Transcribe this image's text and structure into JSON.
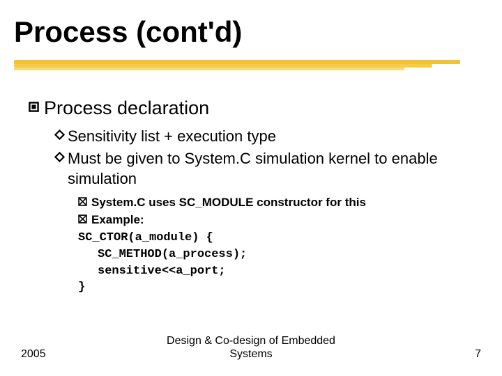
{
  "colors": {
    "accent": "#f1c232",
    "text": "#000000"
  },
  "title": "Process (cont'd)",
  "lvl1": {
    "text": "Process declaration"
  },
  "lvl2": [
    {
      "text": "Sensitivity list + execution type"
    },
    {
      "text": "Must be given to System.C simulation kernel to enable simulation"
    }
  ],
  "lvl3": [
    {
      "text": "System.C uses SC_MODULE constructor for this"
    },
    {
      "text": "Example:"
    }
  ],
  "code": {
    "l0": "SC_CTOR(a_module) {",
    "l1": "SC_METHOD(a_process);",
    "l2": "sensitive<<a_port;",
    "l3": "}"
  },
  "footer": {
    "year": "2005",
    "center_line1": "Design & Co-design of Embedded",
    "center_line2": "Systems",
    "page": "7"
  }
}
